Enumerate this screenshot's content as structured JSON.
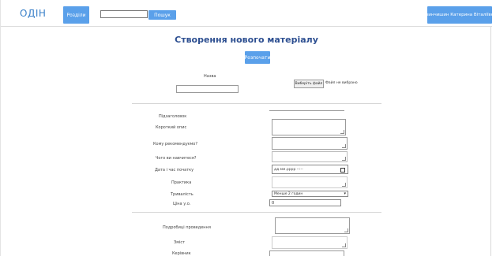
{
  "header": {
    "logo": "ОДІН",
    "sections_label": "Розділи",
    "search_label": "Пошук",
    "user_label": "Гринчишин Катерина Віталіївна"
  },
  "page": {
    "title": "Створення нового матеріалу",
    "create_label": "Розпочати"
  },
  "form": {
    "name_label": "Назва",
    "file_button": "Виберіть файл",
    "file_status": "Файл не вибрано",
    "fields": {
      "subtitle": "Підзаголовок",
      "short_desc": "Короткий опис",
      "recommended": "Кому рекомендуємо?",
      "learn": "Чого ви навчитеся?",
      "date": "Дата і час початку",
      "date_placeholder": "дд.мм.рррр --:--",
      "practice": "Практика",
      "duration": "Тривалість",
      "duration_value": "Менше 2 годин",
      "price": "Ціна у.о.",
      "price_value": "0",
      "detailed": "Подробиці проведення",
      "content": "Зміст",
      "leaders": "Керівник"
    }
  }
}
